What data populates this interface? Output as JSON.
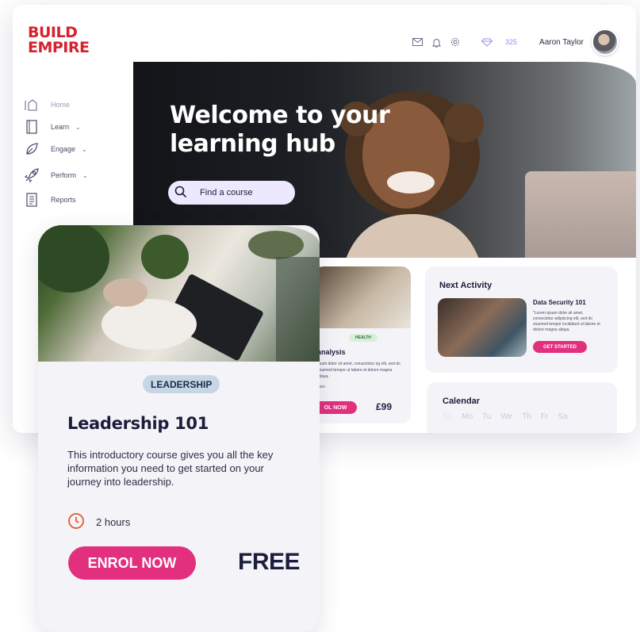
{
  "brand": {
    "line1": "BUILD",
    "line2": "EMPIRE",
    "color": "#d6222f"
  },
  "sidebar": {
    "items": [
      {
        "label": "Home",
        "icon": "home-icon",
        "active": true
      },
      {
        "label": "Learn",
        "icon": "book-icon",
        "chevron": true
      },
      {
        "label": "Engage",
        "icon": "leaf-icon",
        "chevron": true
      },
      {
        "label": "Perform",
        "icon": "rocket-icon",
        "chevron": true
      },
      {
        "label": "Reports",
        "icon": "report-icon"
      }
    ]
  },
  "topbar": {
    "icons": [
      "mail-icon",
      "bell-icon",
      "settings-icon",
      "diamond-icon"
    ],
    "points": "325",
    "user_name": "Aaron Taylor"
  },
  "hero": {
    "title_line1": "Welcome to your",
    "title_line2": "learning hub",
    "search_label": "Find a course"
  },
  "course_card": {
    "tag": "HEALTH",
    "title": "analysis",
    "description": "psum dolor sit amet, consectetur ng elit, sed do eiusmod tempor ut labore et dolore magna aliqua.",
    "small": "ours",
    "enrol_label": "OL NOW",
    "price": "£99"
  },
  "next_activity": {
    "title": "Next Activity",
    "name": "Data Security 101",
    "description": "\"Lorem ipsum dolor sit amet, consectetur adipiscing elit, sed do eiusmod tempor incididunt ut labore et dolore magna aliqua.",
    "button_label": "GET STARTED"
  },
  "calendar": {
    "title": "Calendar",
    "days": [
      "Su",
      "Mo",
      "Tu",
      "We",
      "Th",
      "Fr",
      "Sa"
    ]
  },
  "leadership_card": {
    "badge": "LEADERSHIP",
    "title": "Leadership 101",
    "description": "This introductory course gives you all the key information you need to get started on your journey into leadership.",
    "duration": "2 hours",
    "enrol_label": "ENROL NOW",
    "price": "FREE"
  },
  "colors": {
    "accent": "#e2307f",
    "navy": "#1c1d3c",
    "lavender": "#ece8fe",
    "badge": "#c6d6e4"
  }
}
